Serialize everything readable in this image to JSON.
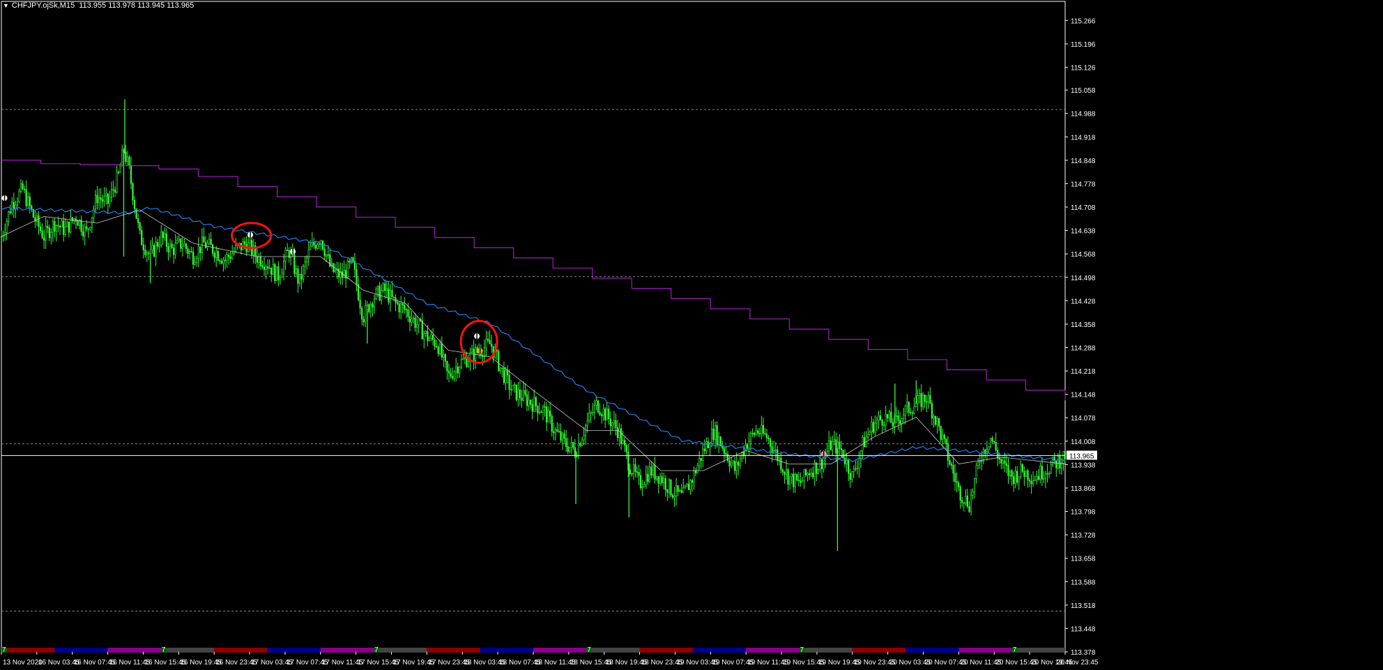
{
  "header": {
    "symbol": "CHFJPY.ojSk,M15",
    "open": "113.955",
    "high": "113.978",
    "low": "113.945",
    "close": "113.965"
  },
  "colors": {
    "background": "#000000",
    "candle": "#33ff33",
    "ma_slow": "#aa22cc",
    "ma_mid": "#2288ff",
    "ma_fast": "#cccccc",
    "current_line": "#ffffff",
    "annotation": "#ff1111",
    "price_box": "#ffffff"
  },
  "chart_data": {
    "type": "candlestick",
    "timeframe": "M15",
    "ylim": [
      113.378,
      115.298
    ],
    "y_ticks": [
      "115.266",
      "115.196",
      "115.126",
      "115.058",
      "114.988",
      "114.918",
      "114.848",
      "114.778",
      "114.708",
      "114.638",
      "114.568",
      "114.498",
      "114.428",
      "114.358",
      "114.288",
      "114.218",
      "114.148",
      "114.078",
      "114.008",
      "113.938",
      "113.868",
      "113.798",
      "113.728",
      "113.658",
      "113.588",
      "113.518",
      "113.448",
      "113.378"
    ],
    "current_price": "113.965",
    "dashed_levels": [
      115.0,
      114.5,
      114.0,
      113.5
    ],
    "x_ticks": [
      "13 Nov 2020",
      "16 Nov 03:45",
      "16 Nov 07:45",
      "16 Nov 11:45",
      "16 Nov 15:45",
      "16 Nov 19:45",
      "16 Nov 23:45",
      "17 Nov 03:45",
      "17 Nov 07:45",
      "17 Nov 11:45",
      "17 Nov 15:45",
      "17 Nov 19:45",
      "17 Nov 23:45",
      "18 Nov 03:45",
      "18 Nov 07:45",
      "18 Nov 11:45",
      "18 Nov 15:45",
      "18 Nov 19:45",
      "18 Nov 23:45",
      "19 Nov 03:45",
      "19 Nov 07:45",
      "19 Nov 11:45",
      "19 Nov 15:45",
      "19 Nov 19:45",
      "19 Nov 23:45",
      "20 Nov 03:45",
      "20 Nov 07:45",
      "20 Nov 11:45",
      "20 Nov 15:45",
      "20 Nov 19:45",
      "20 Nov 23:45"
    ],
    "close_path": [
      {
        "t": 0.0,
        "p": 114.62
      },
      {
        "t": 0.01,
        "p": 114.72
      },
      {
        "t": 0.02,
        "p": 114.76
      },
      {
        "t": 0.03,
        "p": 114.68
      },
      {
        "t": 0.04,
        "p": 114.62
      },
      {
        "t": 0.05,
        "p": 114.66
      },
      {
        "t": 0.06,
        "p": 114.64
      },
      {
        "t": 0.07,
        "p": 114.68
      },
      {
        "t": 0.08,
        "p": 114.63
      },
      {
        "t": 0.09,
        "p": 114.74
      },
      {
        "t": 0.1,
        "p": 114.72
      },
      {
        "t": 0.11,
        "p": 114.8
      },
      {
        "t": 0.115,
        "p": 114.88
      },
      {
        "t": 0.12,
        "p": 114.82
      },
      {
        "t": 0.13,
        "p": 114.62
      },
      {
        "t": 0.14,
        "p": 114.56
      },
      {
        "t": 0.15,
        "p": 114.62
      },
      {
        "t": 0.16,
        "p": 114.58
      },
      {
        "t": 0.17,
        "p": 114.6
      },
      {
        "t": 0.18,
        "p": 114.56
      },
      {
        "t": 0.19,
        "p": 114.6
      },
      {
        "t": 0.2,
        "p": 114.58
      },
      {
        "t": 0.21,
        "p": 114.55
      },
      {
        "t": 0.22,
        "p": 114.58
      },
      {
        "t": 0.23,
        "p": 114.6
      },
      {
        "t": 0.24,
        "p": 114.56
      },
      {
        "t": 0.25,
        "p": 114.54
      },
      {
        "t": 0.26,
        "p": 114.5
      },
      {
        "t": 0.27,
        "p": 114.58
      },
      {
        "t": 0.28,
        "p": 114.48
      },
      {
        "t": 0.29,
        "p": 114.58
      },
      {
        "t": 0.3,
        "p": 114.62
      },
      {
        "t": 0.31,
        "p": 114.52
      },
      {
        "t": 0.32,
        "p": 114.5
      },
      {
        "t": 0.33,
        "p": 114.54
      },
      {
        "t": 0.34,
        "p": 114.38
      },
      {
        "t": 0.35,
        "p": 114.44
      },
      {
        "t": 0.36,
        "p": 114.46
      },
      {
        "t": 0.37,
        "p": 114.42
      },
      {
        "t": 0.38,
        "p": 114.4
      },
      {
        "t": 0.39,
        "p": 114.36
      },
      {
        "t": 0.4,
        "p": 114.32
      },
      {
        "t": 0.41,
        "p": 114.3
      },
      {
        "t": 0.42,
        "p": 114.2
      },
      {
        "t": 0.43,
        "p": 114.24
      },
      {
        "t": 0.44,
        "p": 114.26
      },
      {
        "t": 0.45,
        "p": 114.28
      },
      {
        "t": 0.46,
        "p": 114.3
      },
      {
        "t": 0.47,
        "p": 114.22
      },
      {
        "t": 0.48,
        "p": 114.16
      },
      {
        "t": 0.49,
        "p": 114.14
      },
      {
        "t": 0.5,
        "p": 114.12
      },
      {
        "t": 0.51,
        "p": 114.1
      },
      {
        "t": 0.52,
        "p": 114.04
      },
      {
        "t": 0.53,
        "p": 114.0
      },
      {
        "t": 0.54,
        "p": 113.98
      },
      {
        "t": 0.55,
        "p": 114.06
      },
      {
        "t": 0.56,
        "p": 114.12
      },
      {
        "t": 0.57,
        "p": 114.08
      },
      {
        "t": 0.58,
        "p": 114.04
      },
      {
        "t": 0.59,
        "p": 113.94
      },
      {
        "t": 0.6,
        "p": 113.88
      },
      {
        "t": 0.61,
        "p": 113.92
      },
      {
        "t": 0.62,
        "p": 113.9
      },
      {
        "t": 0.63,
        "p": 113.86
      },
      {
        "t": 0.64,
        "p": 113.84
      },
      {
        "t": 0.65,
        "p": 113.9
      },
      {
        "t": 0.66,
        "p": 113.98
      },
      {
        "t": 0.67,
        "p": 114.04
      },
      {
        "t": 0.68,
        "p": 113.98
      },
      {
        "t": 0.69,
        "p": 113.92
      },
      {
        "t": 0.7,
        "p": 114.0
      },
      {
        "t": 0.71,
        "p": 114.04
      },
      {
        "t": 0.72,
        "p": 114.02
      },
      {
        "t": 0.73,
        "p": 113.96
      },
      {
        "t": 0.74,
        "p": 113.9
      },
      {
        "t": 0.75,
        "p": 113.88
      },
      {
        "t": 0.76,
        "p": 113.92
      },
      {
        "t": 0.77,
        "p": 113.94
      },
      {
        "t": 0.78,
        "p": 114.0
      },
      {
        "t": 0.79,
        "p": 113.98
      },
      {
        "t": 0.8,
        "p": 113.9
      },
      {
        "t": 0.81,
        "p": 114.0
      },
      {
        "t": 0.82,
        "p": 114.06
      },
      {
        "t": 0.83,
        "p": 114.08
      },
      {
        "t": 0.84,
        "p": 114.06
      },
      {
        "t": 0.85,
        "p": 114.1
      },
      {
        "t": 0.86,
        "p": 114.12
      },
      {
        "t": 0.87,
        "p": 114.14
      },
      {
        "t": 0.88,
        "p": 114.06
      },
      {
        "t": 0.89,
        "p": 113.96
      },
      {
        "t": 0.9,
        "p": 113.86
      },
      {
        "t": 0.91,
        "p": 113.82
      },
      {
        "t": 0.92,
        "p": 113.96
      },
      {
        "t": 0.93,
        "p": 114.02
      },
      {
        "t": 0.94,
        "p": 113.94
      },
      {
        "t": 0.95,
        "p": 113.9
      },
      {
        "t": 0.96,
        "p": 113.92
      },
      {
        "t": 0.97,
        "p": 113.9
      },
      {
        "t": 0.98,
        "p": 113.92
      },
      {
        "t": 0.99,
        "p": 113.94
      },
      {
        "t": 1.0,
        "p": 113.965
      }
    ],
    "spikes": [
      {
        "t": 0.116,
        "p": 115.03
      },
      {
        "t": 0.115,
        "p": 114.56
      },
      {
        "t": 0.14,
        "p": 114.48
      },
      {
        "t": 0.344,
        "p": 114.3
      },
      {
        "t": 0.54,
        "p": 113.82
      },
      {
        "t": 0.59,
        "p": 113.78
      },
      {
        "t": 0.786,
        "p": 113.68
      },
      {
        "t": 0.86,
        "p": 114.19
      },
      {
        "t": 0.84,
        "p": 114.18
      }
    ],
    "series": [
      {
        "role": "ma_slow",
        "path": [
          {
            "t": 0.0,
            "p": 114.848
          },
          {
            "t": 0.03,
            "p": 114.848
          },
          {
            "t": 0.035,
            "p": 114.838
          },
          {
            "t": 0.13,
            "p": 114.83
          },
          {
            "t": 0.17,
            "p": 114.812
          },
          {
            "t": 1.0,
            "p": 114.13
          }
        ]
      },
      {
        "role": "ma_mid",
        "path": [
          {
            "t": 0.0,
            "p": 114.705
          },
          {
            "t": 0.12,
            "p": 114.69
          },
          {
            "t": 0.14,
            "p": 114.706
          },
          {
            "t": 0.2,
            "p": 114.65
          },
          {
            "t": 0.3,
            "p": 114.6
          },
          {
            "t": 0.4,
            "p": 114.42
          },
          {
            "t": 0.46,
            "p": 114.36
          },
          {
            "t": 0.55,
            "p": 114.16
          },
          {
            "t": 0.64,
            "p": 114.01
          },
          {
            "t": 0.74,
            "p": 113.97
          },
          {
            "t": 0.8,
            "p": 113.95
          },
          {
            "t": 0.86,
            "p": 113.99
          },
          {
            "t": 0.92,
            "p": 113.975
          },
          {
            "t": 1.0,
            "p": 113.95
          }
        ]
      },
      {
        "role": "ma_fast",
        "path": [
          {
            "t": 0.0,
            "p": 114.62
          },
          {
            "t": 0.04,
            "p": 114.68
          },
          {
            "t": 0.09,
            "p": 114.66
          },
          {
            "t": 0.13,
            "p": 114.7
          },
          {
            "t": 0.18,
            "p": 114.6
          },
          {
            "t": 0.24,
            "p": 114.56
          },
          {
            "t": 0.3,
            "p": 114.56
          },
          {
            "t": 0.34,
            "p": 114.46
          },
          {
            "t": 0.38,
            "p": 114.42
          },
          {
            "t": 0.42,
            "p": 114.28
          },
          {
            "t": 0.46,
            "p": 114.26
          },
          {
            "t": 0.5,
            "p": 114.16
          },
          {
            "t": 0.55,
            "p": 114.04
          },
          {
            "t": 0.58,
            "p": 114.04
          },
          {
            "t": 0.62,
            "p": 113.92
          },
          {
            "t": 0.66,
            "p": 113.92
          },
          {
            "t": 0.7,
            "p": 113.98
          },
          {
            "t": 0.74,
            "p": 113.94
          },
          {
            "t": 0.78,
            "p": 113.94
          },
          {
            "t": 0.82,
            "p": 114.02
          },
          {
            "t": 0.86,
            "p": 114.08
          },
          {
            "t": 0.9,
            "p": 113.94
          },
          {
            "t": 0.94,
            "p": 113.96
          },
          {
            "t": 1.0,
            "p": 113.94
          }
        ]
      }
    ],
    "arrow_signals": [
      {
        "t": 0.003,
        "p": 114.735,
        "color": "#ffffff"
      },
      {
        "t": 0.234,
        "p": 114.625,
        "color": "#ffffff"
      },
      {
        "t": 0.274,
        "p": 114.575,
        "color": "#ffffff"
      },
      {
        "t": 0.447,
        "p": 114.322,
        "color": "#ffffff"
      },
      {
        "t": 0.45,
        "p": 114.278,
        "color": "#ffaa00"
      },
      {
        "t": 0.773,
        "p": 113.97,
        "color": "#ff88cc"
      }
    ],
    "annotations": [
      {
        "shape": "ellipse",
        "t": 0.235,
        "p": 114.623
      },
      {
        "shape": "ellipse",
        "t": 0.449,
        "p": 114.305
      }
    ],
    "session_bands": [
      {
        "color": "#8b0000",
        "label": "7"
      },
      {
        "color": "#000088",
        "label": ""
      },
      {
        "color": "#880088",
        "label": ""
      },
      {
        "color": "#444444",
        "label": "7"
      },
      {
        "color": "#8b0000",
        "label": ""
      },
      {
        "color": "#000088",
        "label": ""
      },
      {
        "color": "#880088",
        "label": ""
      },
      {
        "color": "#444444",
        "label": "7"
      },
      {
        "color": "#8b0000",
        "label": ""
      },
      {
        "color": "#000088",
        "label": ""
      },
      {
        "color": "#880088",
        "label": ""
      },
      {
        "color": "#444444",
        "label": "7"
      },
      {
        "color": "#8b0000",
        "label": ""
      },
      {
        "color": "#000088",
        "label": ""
      },
      {
        "color": "#880088",
        "label": ""
      },
      {
        "color": "#444444",
        "label": "7"
      },
      {
        "color": "#8b0000",
        "label": ""
      },
      {
        "color": "#000088",
        "label": ""
      },
      {
        "color": "#880088",
        "label": ""
      },
      {
        "color": "#444444",
        "label": "7"
      }
    ]
  }
}
